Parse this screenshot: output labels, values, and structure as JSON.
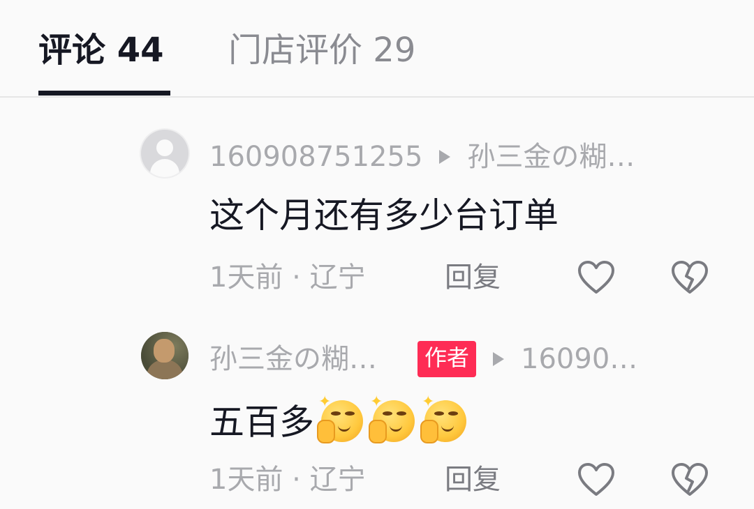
{
  "tabs": {
    "comments": {
      "label": "评论",
      "count": "44"
    },
    "reviews": {
      "label": "门店评价",
      "count": "29"
    }
  },
  "comments": [
    {
      "username": "1609087512​55",
      "reply_to": "孙三金の糊…",
      "text": "这个月还有多少台订单",
      "time": "1天前",
      "separator": "·",
      "location": "辽宁",
      "reply_label": "回复",
      "avatar": "default-avatar-icon"
    },
    {
      "username": "孙三金の糊…",
      "badge": "作者",
      "reply_to": "16090…",
      "text": "五百多",
      "emojis": [
        "smirk-hand-emoji",
        "smirk-hand-emoji",
        "smirk-hand-emoji"
      ],
      "time": "1天前",
      "separator": "·",
      "location": "辽宁",
      "reply_label": "回复",
      "avatar": "photo-avatar"
    }
  ],
  "icons": {
    "like": "heart-outline-icon",
    "dislike": "broken-heart-icon"
  },
  "colors": {
    "primary_text": "#161823",
    "secondary_text": "#a8a9ad",
    "author_badge": "#fe2c55",
    "background": "#fafafa"
  }
}
